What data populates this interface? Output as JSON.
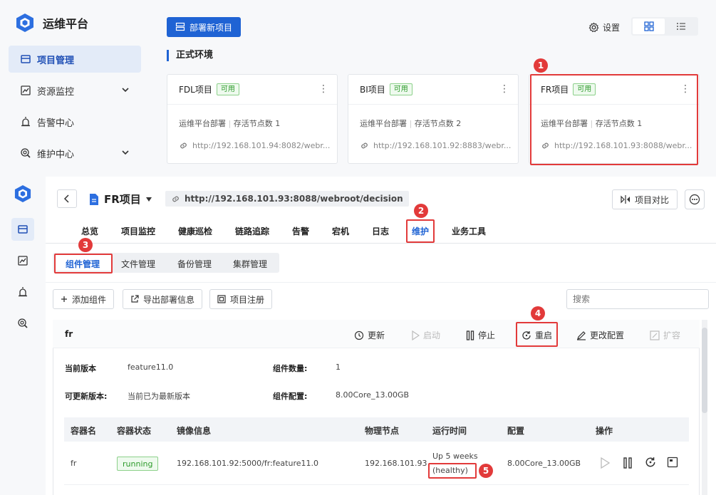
{
  "app": {
    "title": "运维平台"
  },
  "top_nav": [
    {
      "label": "项目管理",
      "icon": "project-icon",
      "active": true
    },
    {
      "label": "资源监控",
      "icon": "monitor-icon",
      "expandable": true
    },
    {
      "label": "告警中心",
      "icon": "alarm-icon"
    },
    {
      "label": "维护中心",
      "icon": "maintenance-icon",
      "expandable": true
    }
  ],
  "header": {
    "deploy_button": "部署新项目",
    "settings_label": "设置"
  },
  "env": {
    "title": "正式环境"
  },
  "cards": [
    {
      "name": "FDL项目",
      "status": "可用",
      "deploy": "运维平台部署",
      "nodes": "存活节点数 1",
      "url": "http://192.168.101.94:8082/webr..."
    },
    {
      "name": "BI项目",
      "status": "可用",
      "deploy": "运维平台部署",
      "nodes": "存活节点数 2",
      "url": "http://192.168.101.92:8883/webr..."
    },
    {
      "name": "FR项目",
      "status": "可用",
      "deploy": "运维平台部署",
      "nodes": "存活节点数 1",
      "url": "http://192.168.101.93:8088/webr..."
    }
  ],
  "callouts": [
    "1",
    "2",
    "3",
    "4",
    "5"
  ],
  "project": {
    "title": "FR项目",
    "url": "http://192.168.101.93:8088/webroot/decision",
    "compare_button": "项目对比"
  },
  "tabs": [
    "总览",
    "项目监控",
    "健康巡检",
    "链路追踪",
    "告警",
    "宕机",
    "日志",
    "维护",
    "业务工具"
  ],
  "active_tab": "维护",
  "subtabs": [
    "组件管理",
    "文件管理",
    "备份管理",
    "集群管理"
  ],
  "active_subtab": "组件管理",
  "toolbar": {
    "add": "添加组件",
    "export": "导出部署信息",
    "register": "项目注册",
    "search_placeholder": "搜索"
  },
  "component": {
    "name": "fr",
    "actions": {
      "update": "更新",
      "start": "启动",
      "stop": "停止",
      "restart": "重启",
      "config": "更改配置",
      "expand": "扩容"
    },
    "current_version_label": "当前版本",
    "current_version": "feature11.0",
    "count_label": "组件数量:",
    "count": "1",
    "updatable_label": "可更新版本:",
    "updatable": "当前已为最新版本",
    "config_label": "组件配置:",
    "config": "8.00Core_13.00GB"
  },
  "table": {
    "headers": [
      "容器名",
      "容器状态",
      "镜像信息",
      "物理节点",
      "运行时间",
      "配置",
      "操作"
    ],
    "rows": [
      {
        "name": "fr",
        "status": "running",
        "image": "192.168.101.92:5000/fr:feature11.0",
        "node": "192.168.101.93",
        "uptime": "Up 5 weeks",
        "health": "(healthy)",
        "config": "8.00Core_13.00GB"
      }
    ]
  },
  "colors": {
    "primary": "#1f63d4",
    "callout": "#e23a3a",
    "ok": "#2c9a2a"
  }
}
